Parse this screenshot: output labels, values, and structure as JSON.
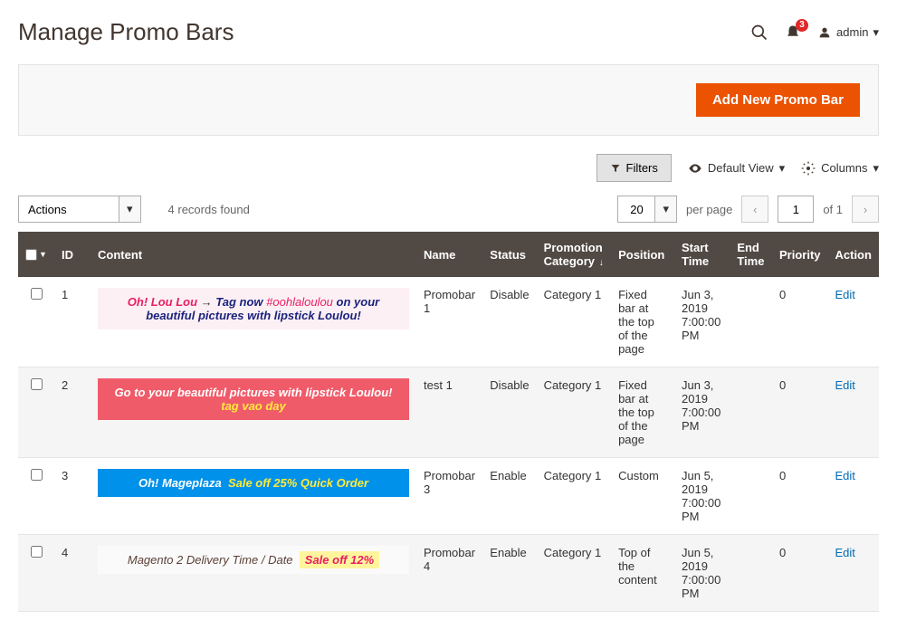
{
  "page": {
    "title": "Manage Promo Bars",
    "admin_label": "admin",
    "notif_count": "3"
  },
  "actions": {
    "add_new": "Add New Promo Bar",
    "filters": "Filters",
    "default_view": "Default View",
    "columns": "Columns",
    "actions_label": "Actions"
  },
  "grid": {
    "records_found": "4 records found",
    "per_page": "20",
    "per_page_label": "per page",
    "current_page": "1",
    "of_label": "of 1"
  },
  "headers": {
    "id": "ID",
    "content": "Content",
    "name": "Name",
    "status": "Status",
    "promotion_category": "Promotion Category",
    "position": "Position",
    "start_time": "Start Time",
    "end_time": "End Time",
    "priority": "Priority",
    "action": "Action"
  },
  "rows": [
    {
      "id": "1",
      "content_type": "promo1",
      "content_parts": {
        "brand": "Oh! Lou Lou",
        "arrow": "→",
        "text1": "Tag now",
        "hashtag": "#oohlaloulou",
        "text2": "on your beautiful pictures with lipstick Loulou!"
      },
      "name": "Promobar 1",
      "status": "Disable",
      "category": "Category 1",
      "position": "Fixed bar at the top of the page",
      "start_time": "Jun 3, 2019 7:00:00 PM",
      "end_time": "",
      "priority": "0",
      "action": "Edit"
    },
    {
      "id": "2",
      "content_type": "promo2",
      "content_parts": {
        "text": "Go to your beautiful pictures with lipstick Loulou!",
        "tag": "tag vao day"
      },
      "name": "test 1",
      "status": "Disable",
      "category": "Category 1",
      "position": "Fixed bar at the top of the page",
      "start_time": "Jun 3, 2019 7:00:00 PM",
      "end_time": "",
      "priority": "0",
      "action": "Edit"
    },
    {
      "id": "3",
      "content_type": "promo3",
      "content_parts": {
        "brand": "Oh! Mageplaza",
        "sale": "Sale off 25% Quick Order"
      },
      "name": "Promobar 3",
      "status": "Enable",
      "category": "Category 1",
      "position": "Custom",
      "start_time": "Jun 5, 2019 7:00:00 PM",
      "end_time": "",
      "priority": "0",
      "action": "Edit"
    },
    {
      "id": "4",
      "content_type": "promo4",
      "content_parts": {
        "text": "Magento 2 Delivery Time / Date",
        "sale": "Sale off 12%"
      },
      "name": "Promobar 4",
      "status": "Enable",
      "category": "Category 1",
      "position": "Top of the content",
      "start_time": "Jun 5, 2019 7:00:00 PM",
      "end_time": "",
      "priority": "0",
      "action": "Edit"
    }
  ]
}
